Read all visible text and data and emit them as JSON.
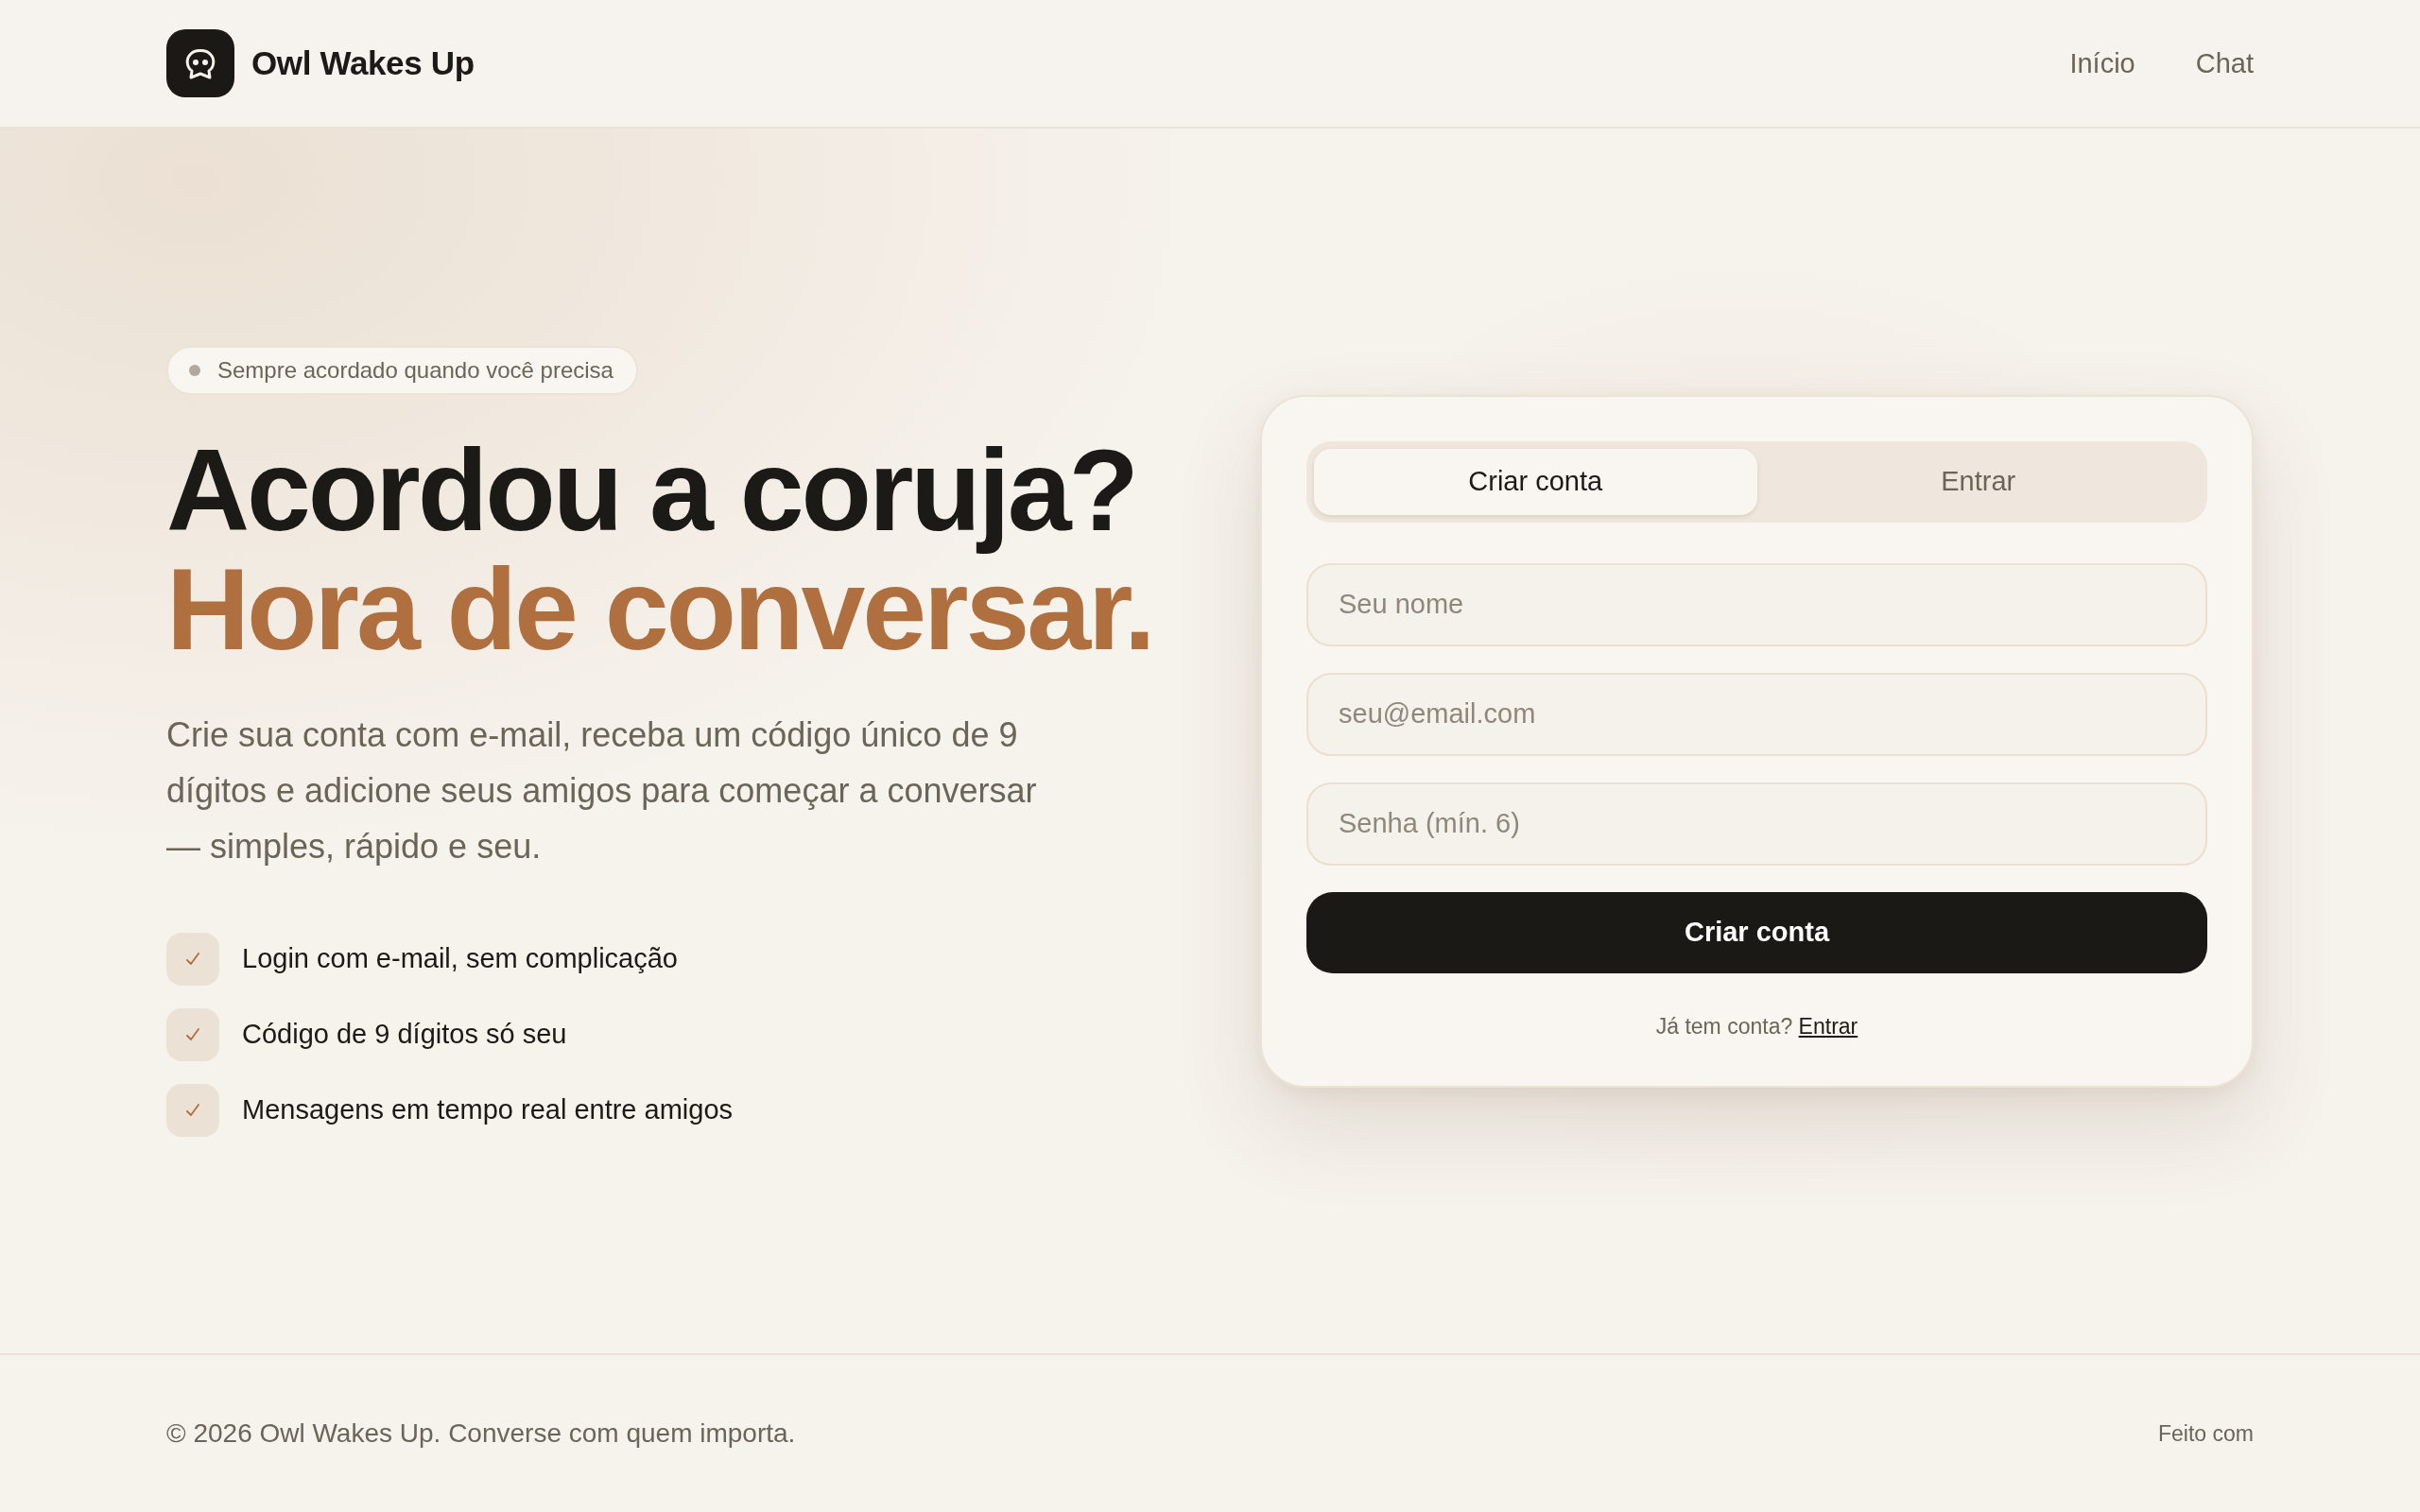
{
  "header": {
    "brand": "Owl Wakes Up",
    "nav": [
      "Início",
      "Chat"
    ]
  },
  "hero": {
    "badge": "Sempre acordado quando você precisa",
    "title": "Acordou a coruja?",
    "title_accent": "Hora de conversar.",
    "description": "Crie sua conta com e-mail, receba um código único de 9 dígitos e adicione seus amigos para começar a conversar — simples, rápido e seu.",
    "features": [
      "Login com e-mail, sem complicação",
      "Código de 9 dígitos só seu",
      "Mensagens em tempo real entre amigos"
    ]
  },
  "auth_card": {
    "tabs": [
      {
        "label": "Criar conta",
        "selected": true
      },
      {
        "label": "Entrar",
        "selected": false
      }
    ],
    "fields": [
      {
        "placeholder": "Seu nome"
      },
      {
        "placeholder": "seu@email.com"
      },
      {
        "placeholder": "Senha (mín. 6)"
      }
    ],
    "submit": "Criar conta",
    "prompt": "Já tem conta?",
    "prompt_link": "Entrar"
  },
  "footer": {
    "copyright": "© 2026 Owl Wakes Up. Converse com quem importa.",
    "credit": "Feito com"
  }
}
